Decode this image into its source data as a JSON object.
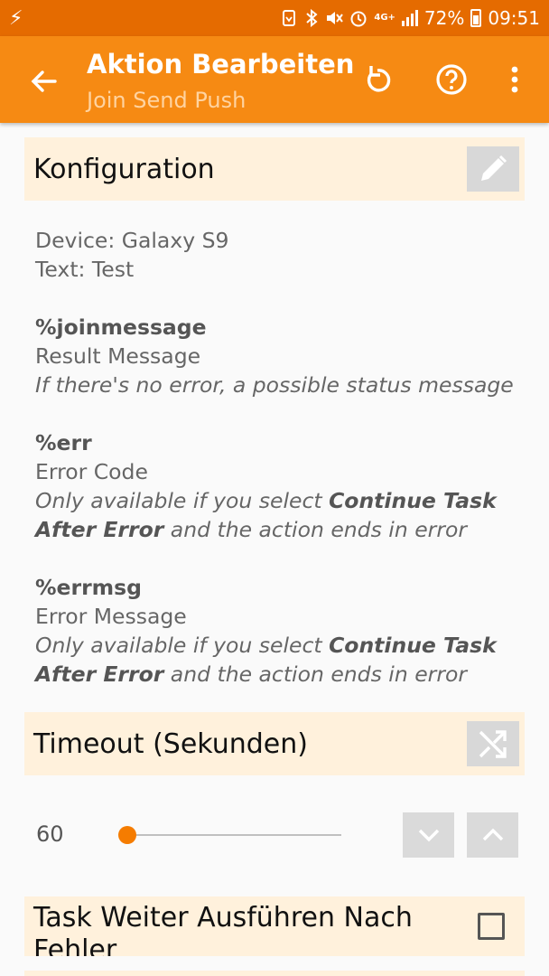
{
  "status_bar": {
    "battery_percent": "72%",
    "time": "09:51",
    "network": "4G+",
    "icons": [
      "flash-icon",
      "alarm-clock-icon",
      "bluetooth-icon",
      "mute-icon",
      "signal-icon",
      "battery-icon"
    ]
  },
  "app_bar": {
    "title": "Aktion Bearbeiten",
    "subtitle": "Join Send Push",
    "icons": [
      "back-arrow-icon",
      "reset-icon",
      "help-icon",
      "more-vert-icon"
    ]
  },
  "configuration": {
    "header": "Konfiguration",
    "device_line": "Device: Galaxy S9",
    "text_line": "Text: Test",
    "variables": [
      {
        "name": "%joinmessage",
        "label": "Result Message",
        "desc_plain": "If there's no error, a possible status message"
      },
      {
        "name": "%err",
        "label": "Error Code",
        "desc_pre": "Only available if you select ",
        "desc_bold_1": "Continue Task",
        "desc_bold_2": "After Error",
        "desc_post": " and the action ends in error"
      },
      {
        "name": "%errmsg",
        "label": "Error Message",
        "desc_pre": "Only available if you select ",
        "desc_bold_1": "Continue Task",
        "desc_bold_2": "After Error",
        "desc_post": " and the action ends in error"
      }
    ]
  },
  "timeout": {
    "header": "Timeout (Sekunden)",
    "value": "60",
    "slider_fraction": 0.0
  },
  "continue_after_error": {
    "label": "Task Weiter Ausführen Nach Fehler",
    "checked": false
  },
  "colors": {
    "status_bar": "#e56b00",
    "app_bar": "#f68a13",
    "subtitle": "#ffd3a0",
    "section_bg": "#fff1dc",
    "slider_thumb": "#f57c00"
  }
}
